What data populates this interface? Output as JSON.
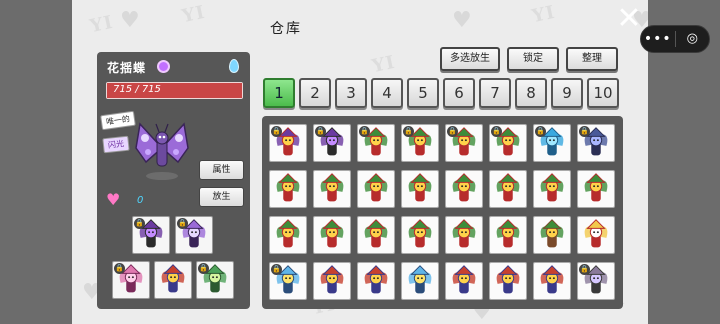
{
  "title": "仓库",
  "pokemon": {
    "name": "花揺蝶",
    "hp_text": "715 / 715",
    "hp_fraction": 1.0,
    "badge_only": "唯一的",
    "badge_shiny": "闪光",
    "friendship": "0"
  },
  "buttons": {
    "multi_release": "多选放生",
    "lock": "锁定",
    "sort": "整理",
    "stats": "属性",
    "release": "放生"
  },
  "tabs": [
    "1",
    "2",
    "3",
    "4",
    "5",
    "6",
    "7",
    "8",
    "9",
    "10"
  ],
  "active_tab": "1",
  "capsule": {
    "more": "•••",
    "target": "◎"
  },
  "close_icon": "✕",
  "watermark": "YI",
  "team": [
    {
      "kind": "witch",
      "locked": true
    },
    {
      "kind": "moth",
      "locked": true
    },
    {
      "kind": "pinkbug",
      "locked": true
    },
    {
      "kind": "fox",
      "locked": false
    },
    {
      "kind": "mantis",
      "locked": true
    }
  ],
  "storage": [
    {
      "kind": "hatwitch",
      "locked": true
    },
    {
      "kind": "witch",
      "locked": true
    },
    {
      "kind": "hatgreen",
      "locked": true
    },
    {
      "kind": "hatgreen",
      "locked": true
    },
    {
      "kind": "hatgreen",
      "locked": true
    },
    {
      "kind": "hatgreen",
      "locked": true
    },
    {
      "kind": "fish",
      "locked": true
    },
    {
      "kind": "crab",
      "locked": true
    },
    {
      "kind": "hatgreen",
      "locked": false
    },
    {
      "kind": "hatgreen",
      "locked": false
    },
    {
      "kind": "hatgreen",
      "locked": false
    },
    {
      "kind": "hatgreen",
      "locked": false
    },
    {
      "kind": "hatgreen",
      "locked": false
    },
    {
      "kind": "hatgreen",
      "locked": false
    },
    {
      "kind": "hatgreen",
      "locked": false
    },
    {
      "kind": "hatgreen",
      "locked": false
    },
    {
      "kind": "hatgreen",
      "locked": false
    },
    {
      "kind": "hatgreen",
      "locked": false
    },
    {
      "kind": "hatgreen",
      "locked": false
    },
    {
      "kind": "hatgreen",
      "locked": false
    },
    {
      "kind": "hatgreen",
      "locked": false
    },
    {
      "kind": "hatgreen",
      "locked": false
    },
    {
      "kind": "elf",
      "locked": false
    },
    {
      "kind": "angel",
      "locked": false
    },
    {
      "kind": "bluefly",
      "locked": true
    },
    {
      "kind": "fox",
      "locked": false
    },
    {
      "kind": "fox",
      "locked": false
    },
    {
      "kind": "bluefly",
      "locked": false
    },
    {
      "kind": "fox",
      "locked": false
    },
    {
      "kind": "fox",
      "locked": false
    },
    {
      "kind": "fox",
      "locked": false
    },
    {
      "kind": "mothgrey",
      "locked": true
    }
  ],
  "colors": {
    "hp_fill": "#c94646",
    "tab_active": "#4cbc4c",
    "panel": "#575757"
  },
  "icons": {
    "gender": "female-icon",
    "drop": "water-drop-icon",
    "heart": "heart-icon",
    "lock": "lock-icon"
  }
}
